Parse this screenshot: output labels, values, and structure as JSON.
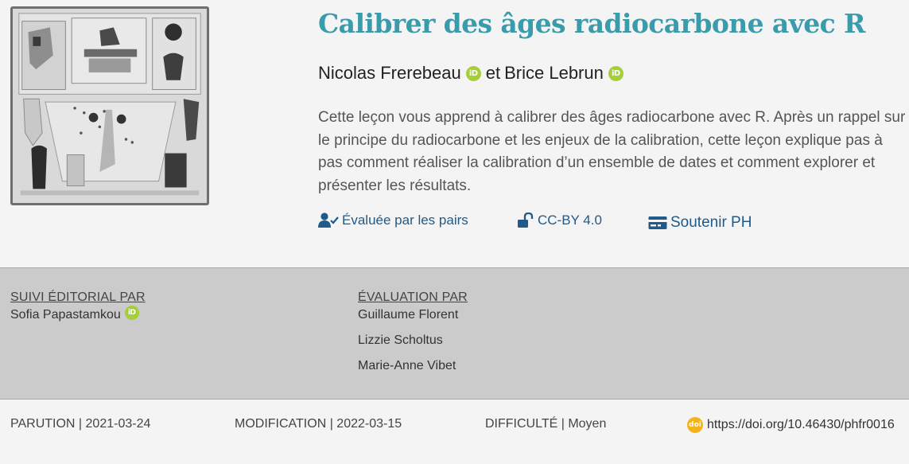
{
  "lesson": {
    "title": "Calibrer des âges radiocarbone avec R",
    "authors": [
      {
        "name": "Nicolas Frerebeau",
        "orcid_icon": "orcid-icon"
      },
      {
        "name": "Brice Lebrun",
        "orcid_icon": "orcid-icon"
      }
    ],
    "authors_separator": "et",
    "abstract": "Cette leçon vous apprend à calibrer des âges radiocarbone avec R. Après un rappel sur le principe du radiocarbone et les enjeux de la calibration, cette leçon explique pas à pas comment réaliser la calibration d’un ensemble de dates et comment explorer et présenter les résultats."
  },
  "badges": {
    "peer_reviewed": {
      "label": "Évaluée par les pairs",
      "icon": "user-check-icon"
    },
    "license": {
      "label": "CC-BY 4.0",
      "icon": "unlock-icon"
    },
    "support": {
      "label": "Soutenir PH",
      "icon": "credit-card-icon"
    }
  },
  "credits": {
    "editorial": {
      "heading": "SUIVI ÉDITORIAL PAR",
      "names": [
        "Sofia Papastamkou"
      ]
    },
    "review": {
      "heading": "ÉVALUATION PAR",
      "names": [
        "Guillaume Florent",
        "Lizzie Scholtus",
        "Marie-Anne Vibet"
      ]
    }
  },
  "meta": {
    "published": "PARUTION | 2021-03-24",
    "modified": "MODIFICATION | 2022-03-15",
    "difficulty_label": "DIFFICULTÉ",
    "difficulty_value": "| Moyen",
    "doi": "https://doi.org/10.46430/phfr0016",
    "doi_icon_text": "doi"
  },
  "colors": {
    "title": "#3a9bab",
    "link": "#1f5a8a",
    "orcid": "#a6ce39",
    "doi": "#f6b21b",
    "credits_band": "#cbcbcb",
    "background": "#f4f4f4"
  }
}
